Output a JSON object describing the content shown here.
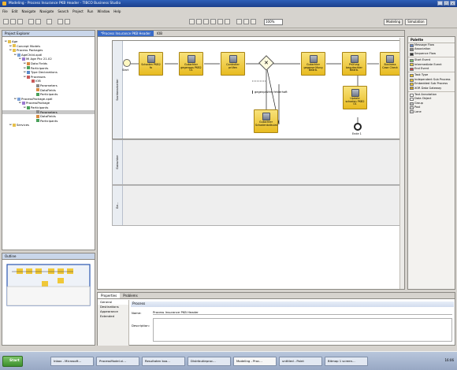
{
  "window": {
    "title": "Modeling - Process Insurance PKB Header - TIBCO Business Studio"
  },
  "menu": [
    "File",
    "Edit",
    "Navigate",
    "Navigate",
    "Search",
    "Project",
    "Run",
    "Window",
    "Help"
  ],
  "toolbar": {
    "zoom": "100%"
  },
  "perspectives": [
    "Modeling",
    "Simulation"
  ],
  "explorer": {
    "tab": "Project Explorer",
    "tree": [
      {
        "indent": 0,
        "label": "Age",
        "icon": "folder-icon"
      },
      {
        "indent": 1,
        "label": "Concept Models",
        "icon": "folder-icon"
      },
      {
        "indent": 1,
        "label": "Process Packages",
        "icon": "folder-icon"
      },
      {
        "indent": 2,
        "label": "AgeChild.xpdl",
        "icon": "file-icon"
      },
      {
        "indent": 3,
        "label": "Mi Age Pkc 21.02",
        "icon": "package-icon"
      },
      {
        "indent": 4,
        "label": "Data Fields",
        "icon": "field-icon"
      },
      {
        "indent": 4,
        "label": "Participants",
        "icon": "participant-icon"
      },
      {
        "indent": 4,
        "label": "Type Declarations",
        "icon": "type-icon"
      },
      {
        "indent": 4,
        "label": "Processes",
        "icon": "process-icon"
      },
      {
        "indent": 5,
        "label": "IOB",
        "icon": "process-icon"
      },
      {
        "indent": 6,
        "label": "Parameters",
        "icon": "param-icon"
      },
      {
        "indent": 6,
        "label": "DataFields",
        "icon": "field-icon"
      },
      {
        "indent": 6,
        "label": "Participants",
        "icon": "participant-icon"
      },
      {
        "indent": 2,
        "label": "ProcessPackage.xpdl",
        "icon": "file-icon"
      },
      {
        "indent": 3,
        "label": "ProcessPackage",
        "icon": "package-icon"
      },
      {
        "indent": 4,
        "label": "Participants",
        "icon": "participant-icon"
      },
      {
        "indent": 6,
        "label": "Parameters",
        "icon": "param-icon"
      },
      {
        "indent": 6,
        "label": "DataFields",
        "icon": "field-icon"
      },
      {
        "indent": 6,
        "label": "Participants",
        "icon": "participant-icon"
      },
      {
        "indent": 1,
        "label": "Services",
        "icon": "folder-icon"
      }
    ]
  },
  "outline": {
    "tab": "Outline"
  },
  "editor": {
    "tabs": [
      "*Process Insurance PKB Header",
      "IOB"
    ],
    "lanes": [
      "Sachbearbeiter",
      "Gutachter",
      "Ge..."
    ],
    "start_label": "Start",
    "end_label": "Ende 1",
    "tasks": [
      "Schaden PKB2 fo",
      "Gutachter gegenpos PKB2 01",
      "Controller prüfen",
      "Gutachter gegenprüfung Bearb.",
      "Prüfung begutachter Bearb.",
      "Business Case Check",
      "Update schaden PKB2 01",
      "Gutachter Schadenkalkulation"
    ],
    "annotation": "gegenprüfen fehlerhaft"
  },
  "palette": {
    "title": "Palette",
    "items": [
      {
        "label": "Message Flow",
        "icon": "message-flow-icon"
      },
      {
        "label": "Association",
        "icon": "association-icon"
      },
      {
        "label": "Sequence Flow",
        "icon": "sequence-flow-icon"
      },
      {
        "label": "Start Event",
        "icon": "start-event-icon"
      },
      {
        "label": "Intermediate Event",
        "icon": "intermediate-event-icon"
      },
      {
        "label": "End Event",
        "icon": "end-event-icon"
      },
      {
        "label": "Task Type",
        "icon": "task-icon"
      },
      {
        "label": "Independent Sub Process",
        "icon": "subprocess-icon"
      },
      {
        "label": "Embedded Sub Process",
        "icon": "subprocess-icon"
      },
      {
        "label": "XOR Data Gateway",
        "icon": "gateway-icon"
      },
      {
        "label": "Text Annotation",
        "icon": "annotation-icon"
      },
      {
        "label": "Data Object",
        "icon": "data-object-icon"
      },
      {
        "label": "Group",
        "icon": "group-icon"
      },
      {
        "label": "Pool",
        "icon": "pool-icon"
      },
      {
        "label": "Lane",
        "icon": "lane-icon"
      }
    ]
  },
  "properties": {
    "tabs": [
      "Properties",
      "Problems"
    ],
    "section": "Process",
    "side": [
      "General",
      "Destinations",
      "Appearance",
      "Extended"
    ],
    "name_label": "Name:",
    "name_value": "Process Insurance PKB Header",
    "desc_label": "Description:"
  },
  "taskbar": {
    "start": "Start",
    "buttons": [
      "Inbox - Microsoft...",
      "ProcessModel.vi...",
      "Resultaten koa...",
      "Distributieproc...",
      "Modeling - Proc...",
      "untitled - Paint",
      "Bitmap 1 screen..."
    ],
    "active_index": 4,
    "clock": "16:06"
  }
}
